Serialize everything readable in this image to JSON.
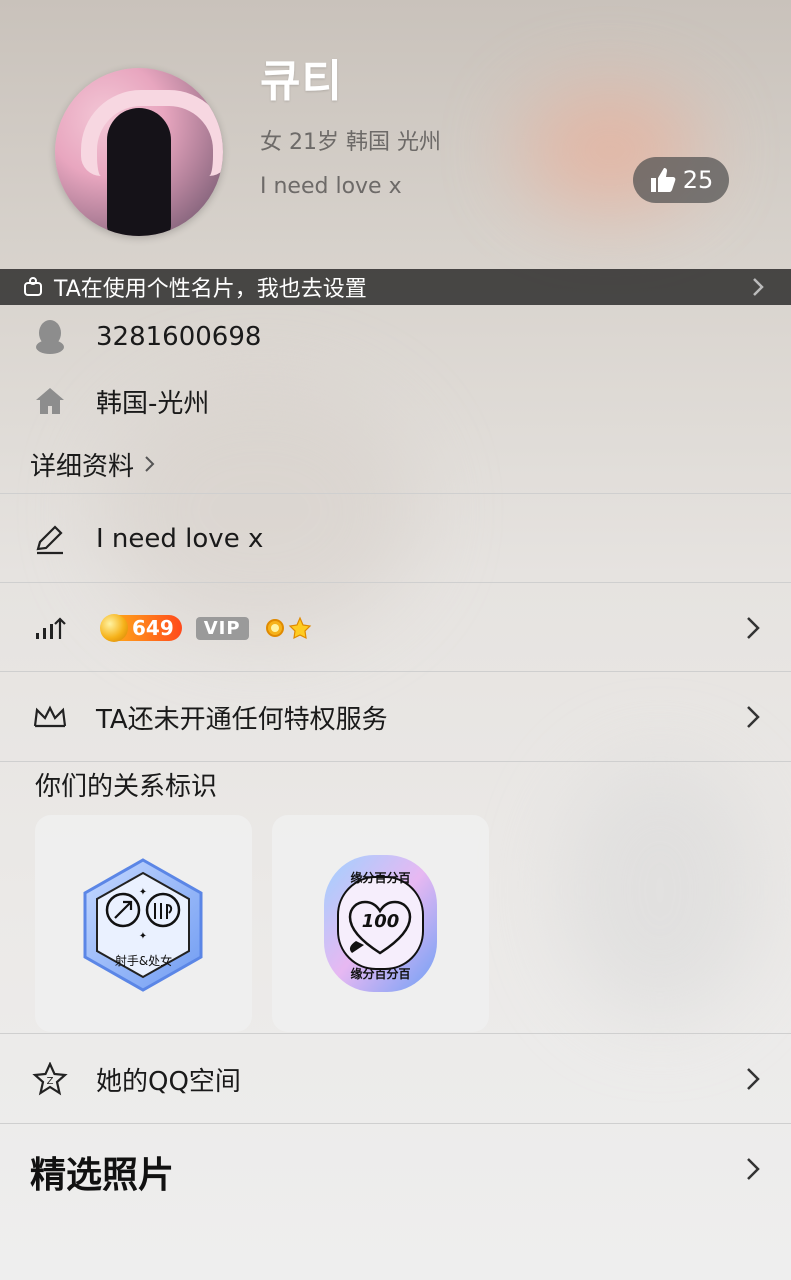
{
  "profile": {
    "name": "큐티",
    "subtitle": "女 21岁 韩国 光州",
    "bio": "I need love x",
    "likes": "25"
  },
  "banner": {
    "text": "TA在使用个性名片，我也去设置"
  },
  "info": {
    "qq": "3281600698",
    "location": "韩国-光州",
    "detail_link": "详细资料"
  },
  "signature": "I need love x",
  "level": {
    "coins": "649",
    "vip": "VIP"
  },
  "privilege": "TA还未开通任何特权服务",
  "relations": {
    "title": "你们的关系标识",
    "badge1_text": "射手&处女",
    "badge2_top": "缘分百分百",
    "badge2_value": "100",
    "badge2_bottom": "缘分百分百"
  },
  "qzone": "她的QQ空间",
  "photos_title": "精选照片",
  "colors": {
    "accent": "#ff4a1c",
    "divider": "#cfcfcf"
  }
}
